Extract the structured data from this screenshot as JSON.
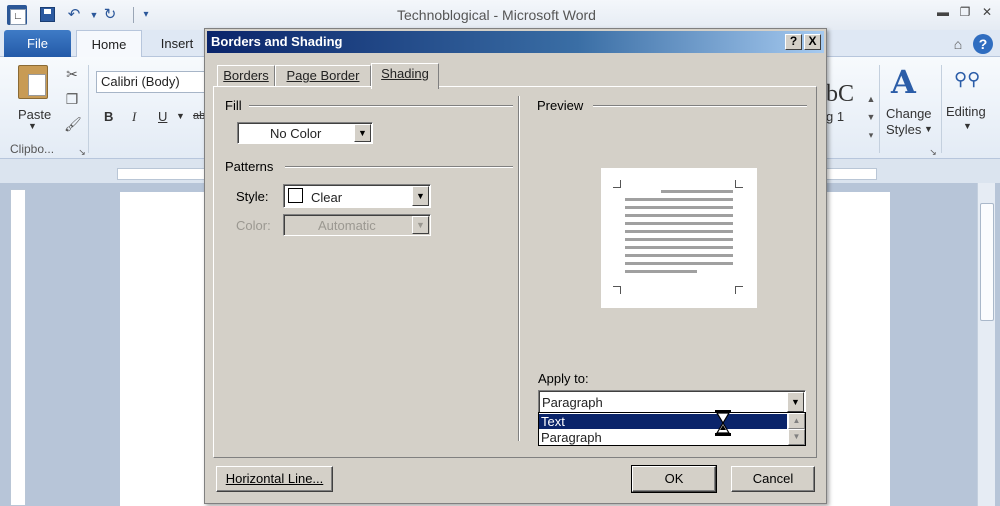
{
  "window": {
    "title": "Technoblogical - Microsoft Word",
    "app_icon": "W"
  },
  "quick_access": {
    "save": "save-icon",
    "undo": "undo-icon",
    "redo": "redo-icon"
  },
  "tabs": {
    "file": "File",
    "home": "Home",
    "insert": "Insert"
  },
  "ribbon": {
    "paste": "Paste",
    "clipboard": "Clipbo...",
    "font_name": "Calibri (Body)",
    "bold": "B",
    "italic": "I",
    "underline": "U",
    "strike": "ab",
    "style_preview": "bC",
    "style_name": "g 1",
    "change_styles": "Change",
    "change_styles_2": "Styles",
    "editing": "Editing"
  },
  "dialog": {
    "title": "Borders and Shading",
    "help": "?",
    "close": "X",
    "tabs": [
      "Borders",
      "Page Border",
      "Shading"
    ],
    "active_tab": "Shading",
    "fill": {
      "label": "Fill",
      "value": "No Color"
    },
    "patterns": {
      "label": "Patterns",
      "style_label": "Style:",
      "style_value": "Clear",
      "color_label": "Color:",
      "color_value": "Automatic"
    },
    "preview": {
      "label": "Preview"
    },
    "apply_to": {
      "label": "Apply to:",
      "value": "Paragraph",
      "options": [
        "Text",
        "Paragraph"
      ],
      "highlighted": "Text"
    },
    "buttons": {
      "horizontal_line": "Horizontal Line...",
      "ok": "OK",
      "cancel": "Cancel"
    }
  },
  "colors": {
    "dialog_bg": "#d4d0c8",
    "title_start": "#0a246a",
    "title_end": "#a6caf0",
    "selection": "#0a246a",
    "file_tab": "#2b5797"
  }
}
